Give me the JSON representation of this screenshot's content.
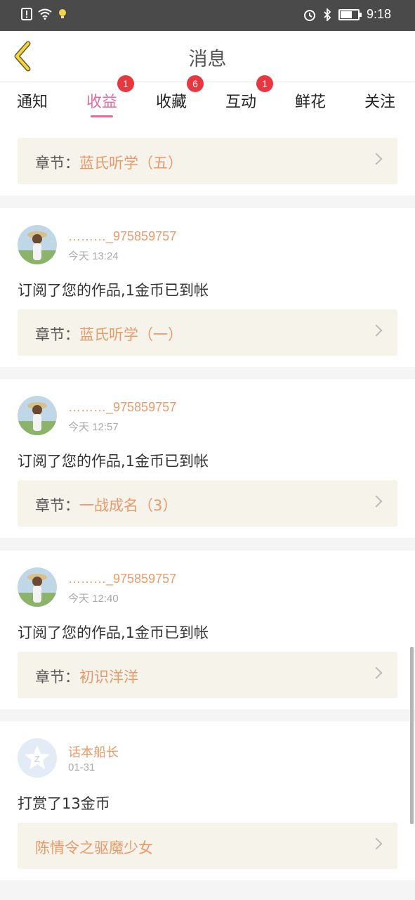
{
  "status_bar": {
    "time": "9:18"
  },
  "header": {
    "title": "消息"
  },
  "tabs": [
    {
      "label": "通知",
      "badge": ""
    },
    {
      "label": "收益",
      "badge": "1",
      "active": true
    },
    {
      "label": "收藏",
      "badge": "6"
    },
    {
      "label": "互动",
      "badge": "1"
    },
    {
      "label": "鲜花",
      "badge": ""
    },
    {
      "label": "关注",
      "badge": ""
    }
  ],
  "items": [
    {
      "chapter_label": "章节：",
      "chapter_value": "蓝氏听学（五）"
    },
    {
      "user": "………_975859757",
      "time": "今天 13:24",
      "message": "订阅了您的作品,1金币已到帐",
      "chapter_label": "章节：",
      "chapter_value": "蓝氏听学（一）"
    },
    {
      "user": "………_975859757",
      "time": "今天 12:57",
      "message": "订阅了您的作品,1金币已到帐",
      "chapter_label": "章节：",
      "chapter_value": "一战成名（3）"
    },
    {
      "user": "………_975859757",
      "time": "今天 12:40",
      "message": "订阅了您的作品,1金币已到帐",
      "chapter_label": "章节：",
      "chapter_value": "初识洋洋"
    },
    {
      "user": "话本船长",
      "time": "01-31",
      "message": "打赏了13金币",
      "chapter_label": "",
      "chapter_value": "陈情令之驱魔少女"
    }
  ],
  "colors": {
    "accent_pink": "#e26b9e",
    "accent_orange": "#e89a6a",
    "badge_red": "#e8373e"
  }
}
